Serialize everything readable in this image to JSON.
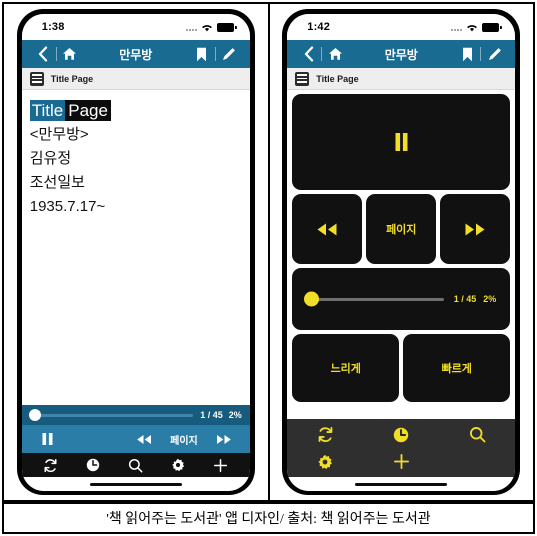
{
  "caption": "'책 읽어주는 도서관' 앱 디자인/ 출처: 책 읽어주는 도서관",
  "left_phone": {
    "status": {
      "time": "1:38",
      "wifi_icon": "wifi-icon",
      "battery_icon": "battery-icon",
      "signal_icon": "signal-dots-icon"
    },
    "navbar": {
      "back_icon": "chevron-left-icon",
      "home_icon": "home-icon",
      "title": "만무방",
      "bookmark_icon": "bookmark-icon",
      "pencil_icon": "pencil-icon"
    },
    "toc": {
      "icon": "list-icon",
      "label": "Title Page"
    },
    "content": {
      "highlight_first": "Title",
      "highlight_second": "Page",
      "lines": [
        "<만무방>",
        "김유정",
        "조선일보",
        "1935.7.17~"
      ]
    },
    "slider": {
      "page": "1 / 45",
      "percent": "2%",
      "value": 0
    },
    "mediabar": {
      "pause_icon": "pause-icon",
      "rewind_icon": "rewind-icon",
      "page_label": "페이지",
      "forward_icon": "fast-forward-icon"
    },
    "tabbar": [
      {
        "icon": "refresh-icon",
        "name": "refresh"
      },
      {
        "icon": "clock-icon",
        "name": "clock"
      },
      {
        "icon": "search-icon",
        "name": "search"
      },
      {
        "icon": "gear-icon",
        "name": "settings"
      },
      {
        "icon": "plus-icon",
        "name": "add"
      }
    ]
  },
  "right_phone": {
    "status": {
      "time": "1:42",
      "wifi_icon": "wifi-icon",
      "battery_icon": "battery-icon",
      "signal_icon": "signal-dots-icon"
    },
    "navbar": {
      "back_icon": "chevron-left-icon",
      "home_icon": "home-icon",
      "title": "만무방",
      "bookmark_icon": "bookmark-icon",
      "pencil_icon": "pencil-icon"
    },
    "toc": {
      "icon": "list-icon",
      "label": "Title Page"
    },
    "deck": {
      "pause_icon": "pause-icon",
      "rewind_icon": "rewind-icon",
      "page_label": "페이지",
      "forward_icon": "fast-forward-icon",
      "slider": {
        "page": "1 / 45",
        "percent": "2%",
        "value": 0
      },
      "slow_label": "느리게",
      "fast_label": "빠르게"
    },
    "icon_deck": {
      "row1": [
        {
          "icon": "refresh-icon",
          "name": "refresh"
        },
        {
          "icon": "clock-icon",
          "name": "clock"
        },
        {
          "icon": "search-icon",
          "name": "search"
        }
      ],
      "row2": [
        {
          "icon": "gear-icon",
          "name": "settings"
        },
        {
          "icon": "plus-icon",
          "name": "add"
        }
      ]
    }
  },
  "colors": {
    "nav_blue": "#1a6b92",
    "media_blue": "#2a7da6",
    "slider_blue": "#175b7e",
    "accent_yellow": "#f2dd28",
    "panel_black": "#111111",
    "deck_gray": "#2f2f2f"
  }
}
